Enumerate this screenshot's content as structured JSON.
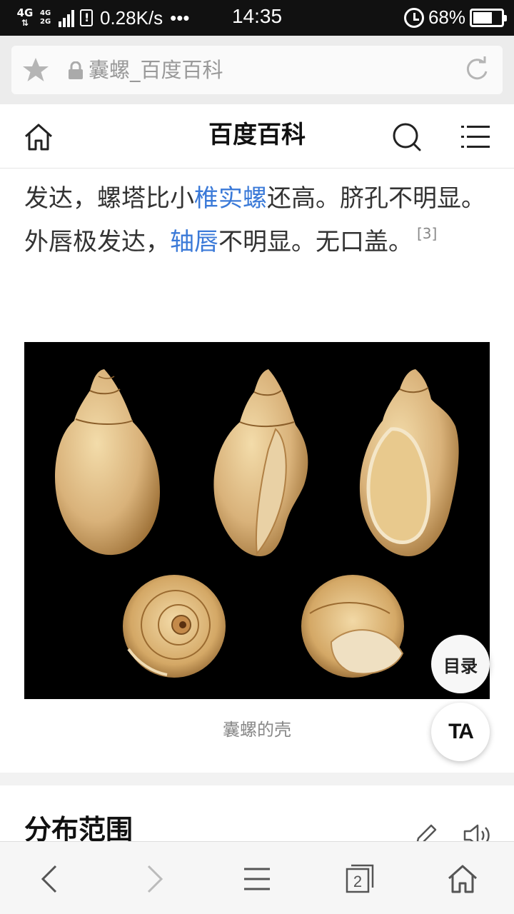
{
  "status_bar": {
    "network_primary": "4G",
    "network_secondary_top": "4G",
    "network_secondary_bottom": "2G",
    "speed": "0.28K/s",
    "more": "•••",
    "time": "14:35",
    "battery_percent": "68%",
    "battery_level": 0.68
  },
  "address_bar": {
    "page_title": "囊螺_百度百科"
  },
  "site_header": {
    "brand": "百度百科"
  },
  "article": {
    "t1": "发达，螺塔比小",
    "link1": "椎实螺",
    "t2": "还高。脐孔不明显。外唇极发达，",
    "link2": "轴唇",
    "t3": "不明显。无口盖。",
    "ref": "[3]"
  },
  "figure": {
    "caption": "囊螺的壳"
  },
  "floating": {
    "toc_label": "目录",
    "text_size_label": "TA"
  },
  "next_section": {
    "title": "分布范围"
  },
  "colors": {
    "link": "#3b7ad8",
    "status_bar_bg": "#111111",
    "shell": "#d9b27a"
  }
}
